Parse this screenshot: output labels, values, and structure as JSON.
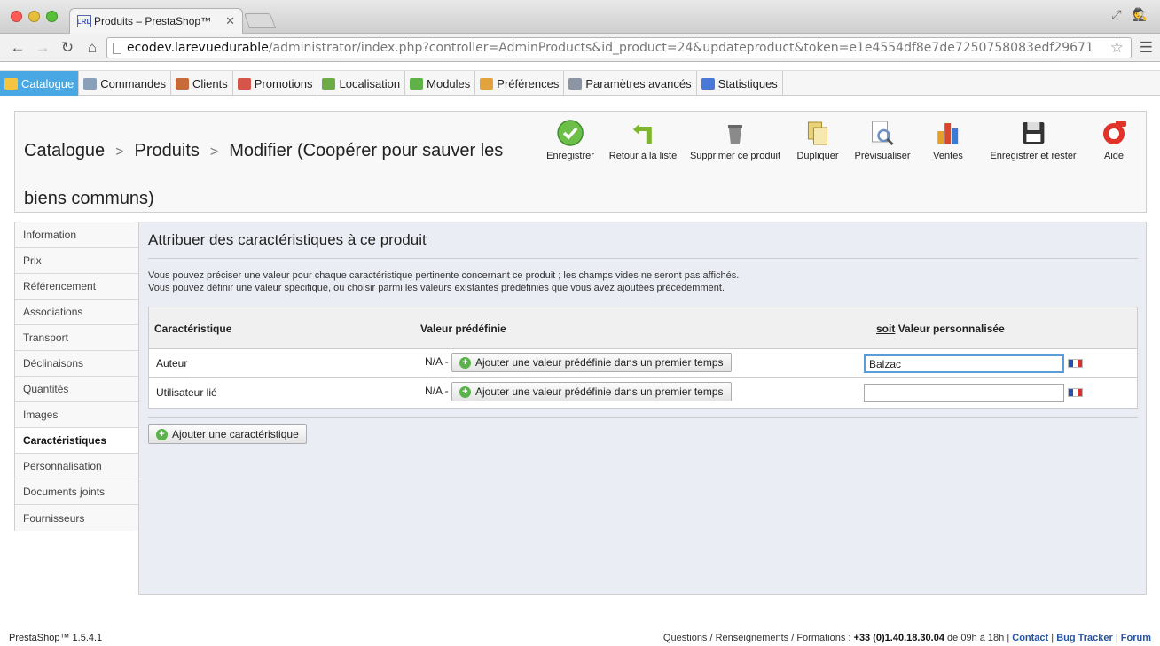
{
  "browser": {
    "tab_title": "Produits – PrestaShop™",
    "favicon_text": "LRD",
    "url_host": "ecodev.larevuedurable",
    "url_path": "/administrator/index.php?controller=AdminProducts&id_product=24&updateproduct&token=e1e4554df8e7de7250758083edf29671"
  },
  "topmenu": [
    {
      "label": "Catalogue",
      "icon": "folder-icon",
      "color": "#f5c542",
      "active": true
    },
    {
      "label": "Commandes",
      "icon": "cart-icon",
      "color": "#8aa0b8",
      "active": false
    },
    {
      "label": "Clients",
      "icon": "user-icon",
      "color": "#c96a3a",
      "active": false
    },
    {
      "label": "Promotions",
      "icon": "voucher-icon",
      "color": "#d6554a",
      "active": false
    },
    {
      "label": "Localisation",
      "icon": "globe-icon",
      "color": "#6cab45",
      "active": false
    },
    {
      "label": "Modules",
      "icon": "puzzle-icon",
      "color": "#5fb148",
      "active": false
    },
    {
      "label": "Préférences",
      "icon": "prefs-icon",
      "color": "#e3a33c",
      "active": false
    },
    {
      "label": "Paramètres avancés",
      "icon": "wrench-icon",
      "color": "#8c95a3",
      "active": false
    },
    {
      "label": "Statistiques",
      "icon": "stats-icon",
      "color": "#4a78d6",
      "active": false
    }
  ],
  "breadcrumb": {
    "part1": "Catalogue",
    "part2": "Produits",
    "part3": "Modifier (Coopérer pour sauver les biens communs)"
  },
  "actions": [
    {
      "label": "Enregistrer",
      "icon": "save-check-icon",
      "color": "#6cc04a"
    },
    {
      "label": "Retour à la liste",
      "icon": "back-arrow-icon",
      "color": "#7db52b"
    },
    {
      "label": "Supprimer ce produit",
      "icon": "trash-icon",
      "color": "#8a8a8a"
    },
    {
      "label": "Dupliquer",
      "icon": "duplicate-icon",
      "color": "#e8d27a"
    },
    {
      "label": "Prévisualiser",
      "icon": "preview-icon",
      "color": "#6b8fc4"
    },
    {
      "label": "Ventes",
      "icon": "sales-chart-icon",
      "color": "#d9482c"
    },
    {
      "label": "Enregistrer et rester",
      "icon": "floppy-icon",
      "color": "#333333"
    },
    {
      "label": "Aide",
      "icon": "lifebuoy-icon",
      "color": "#e0332a"
    }
  ],
  "lefttabs": [
    {
      "label": "Information",
      "active": false
    },
    {
      "label": "Prix",
      "active": false
    },
    {
      "label": "Référencement",
      "active": false
    },
    {
      "label": "Associations",
      "active": false
    },
    {
      "label": "Transport",
      "active": false
    },
    {
      "label": "Déclinaisons",
      "active": false
    },
    {
      "label": "Quantités",
      "active": false
    },
    {
      "label": "Images",
      "active": false
    },
    {
      "label": "Caractéristiques",
      "active": true
    },
    {
      "label": "Personnalisation",
      "active": false
    },
    {
      "label": "Documents joints",
      "active": false
    },
    {
      "label": "Fournisseurs",
      "active": false
    }
  ],
  "main": {
    "title": "Attribuer des caractéristiques à ce produit",
    "desc_line1": "Vous pouvez préciser une valeur pour chaque caractéristique pertinente concernant ce produit ; les champs vides ne seront pas affichés.",
    "desc_line2": "Vous pouvez définir une valeur spécifique, ou choisir parmi les valeurs existantes prédéfinies que vous avez ajoutées précédemment.",
    "table": {
      "col_feature": "Caractéristique",
      "col_predefined": "Valeur prédéfinie",
      "col_custom_soit": "soit",
      "col_custom": "Valeur personnalisée",
      "rows": [
        {
          "name": "Auteur",
          "na": "N/A -",
          "button": "Ajouter une valeur prédéfinie dans un premier temps",
          "custom_value": "Balzac"
        },
        {
          "name": "Utilisateur lié",
          "na": "N/A -",
          "button": "Ajouter une valeur prédéfinie dans un premier temps",
          "custom_value": ""
        }
      ]
    },
    "add_feature_button": "Ajouter une caractéristique"
  },
  "footer": {
    "version": "PrestaShop™ 1.5.4.1",
    "contact_prefix": "Questions / Renseignements / Formations :",
    "phone": "+33 (0)1.40.18.30.04",
    "hours": "de 09h à 18h |",
    "link_contact": "Contact",
    "sep1": "|",
    "link_bugtracker": "Bug Tracker",
    "sep2": "|",
    "link_forum": "Forum"
  },
  "colors": {
    "accent": "#49a7e4",
    "panel_bg": "#ebedf4",
    "link": "#2553a3"
  }
}
